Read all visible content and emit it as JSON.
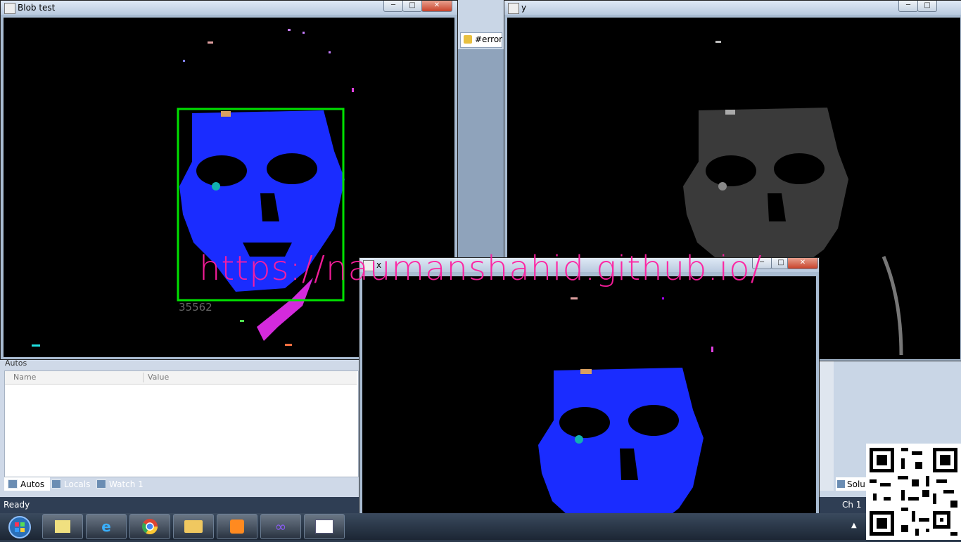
{
  "blob_window": {
    "title": "Blob test",
    "blob_label": "35562",
    "bbox_color": "#00e000",
    "face_color": "#1a2cff"
  },
  "y_window": {
    "title": "y"
  },
  "third_window": {
    "title": "x"
  },
  "ide": {
    "error_label": "#error",
    "status": "Ready",
    "channel": "Ch 1",
    "solution_tab": "Solu"
  },
  "autos": {
    "title": "Autos",
    "columns": [
      "Name",
      "Value"
    ],
    "tabs": [
      {
        "label": "Autos"
      },
      {
        "label": "Locals"
      },
      {
        "label": "Watch 1"
      }
    ]
  },
  "watermark": "https://naumanshahid.github.io/",
  "taskbar": {
    "icons": [
      "start-orb-icon",
      "sticky-notes-icon",
      "internet-explorer-icon",
      "chrome-icon",
      "file-explorer-icon",
      "media-player-icon",
      "visual-studio-icon",
      "window-app-icon"
    ]
  },
  "title_buttons": {
    "minimize": "─",
    "maximize": "□",
    "close": "✕"
  }
}
